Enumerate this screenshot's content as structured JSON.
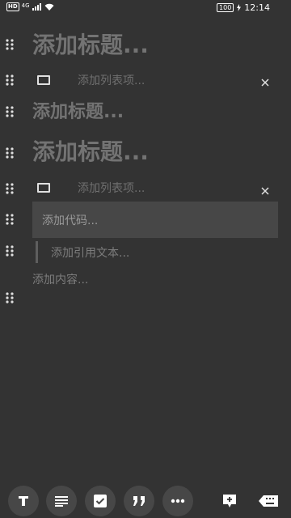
{
  "status_bar": {
    "hd_badge": "HD",
    "network": "4G",
    "battery": "100",
    "time": "12:14"
  },
  "blocks": [
    {
      "type": "heading-large",
      "placeholder": "添加标题..."
    },
    {
      "type": "checklist",
      "placeholder": "添加列表项..."
    },
    {
      "type": "heading-medium",
      "placeholder": "添加标题..."
    },
    {
      "type": "heading-large",
      "placeholder": "添加标题..."
    },
    {
      "type": "checklist",
      "placeholder": "添加列表项..."
    },
    {
      "type": "code",
      "placeholder": "添加代码..."
    },
    {
      "type": "quote",
      "placeholder": "添加引用文本..."
    },
    {
      "type": "paragraph",
      "placeholder": "添加内容..."
    }
  ],
  "toolbar": {
    "items": [
      {
        "icon": "text-format-icon"
      },
      {
        "icon": "paragraph-icon"
      },
      {
        "icon": "checkbox-icon"
      },
      {
        "icon": "quote-icon"
      },
      {
        "icon": "more-icon"
      },
      {
        "icon": "add-block-icon"
      },
      {
        "icon": "keyboard-hide-icon"
      }
    ]
  },
  "colors": {
    "background": "#333333",
    "block_highlight": "#474747",
    "placeholder_text": "#777777",
    "icon": "#ffffff"
  }
}
